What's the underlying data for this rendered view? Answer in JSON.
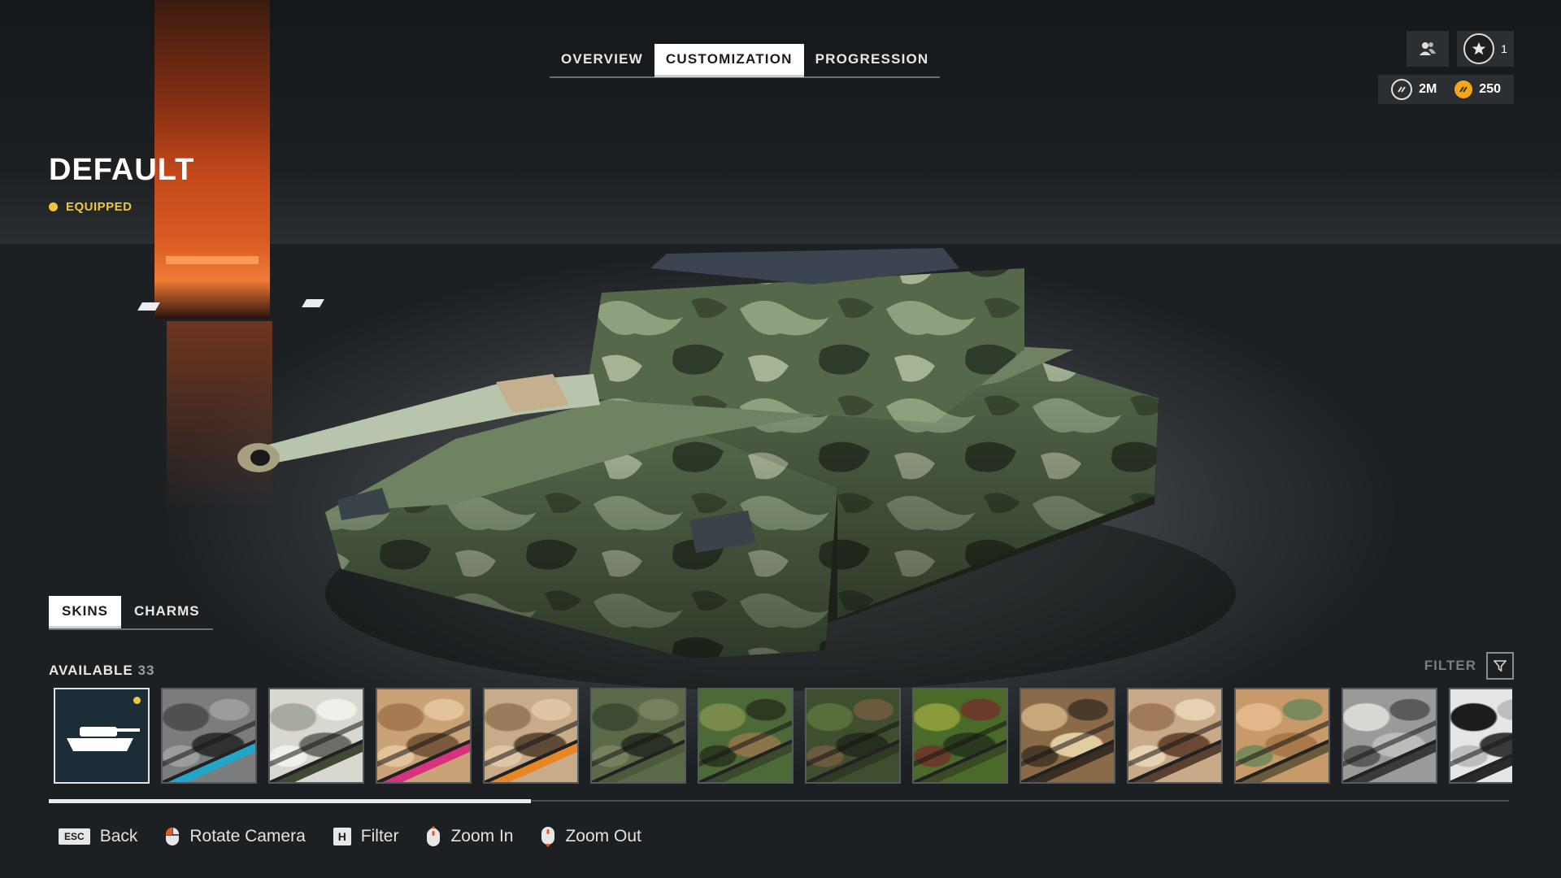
{
  "nav": {
    "tabs": [
      {
        "label": "OVERVIEW"
      },
      {
        "label": "CUSTOMIZATION"
      },
      {
        "label": "PROGRESSION"
      }
    ],
    "active_tab": "CUSTOMIZATION"
  },
  "player": {
    "rank_level": "1"
  },
  "currency": {
    "credits": "2M",
    "gold": "250",
    "gold_color": "#f2a81a"
  },
  "item": {
    "name": "DEFAULT",
    "status": "EQUIPPED",
    "status_color": "#f2c63a"
  },
  "subtabs": [
    {
      "label": "SKINS"
    },
    {
      "label": "CHARMS"
    }
  ],
  "available": {
    "label": "AVAILABLE",
    "count": "33"
  },
  "filter": {
    "label": "FILTER"
  },
  "skins": [
    {
      "name": "default-tank",
      "icon": "tank-icon",
      "selected": true,
      "new": true
    },
    {
      "name": "urban-grey",
      "colors": [
        "#7a7c7e",
        "#4e5052",
        "#9a9c9e",
        "#2f3133"
      ],
      "stripe": "#1fa6c8"
    },
    {
      "name": "snow",
      "colors": [
        "#d8d8d0",
        "#a7aaa0",
        "#f0f0ea",
        "#6c6e66"
      ],
      "stripe": "#3f4a35"
    },
    {
      "name": "desert-tan",
      "colors": [
        "#c9a278",
        "#a67b52",
        "#e2c39c",
        "#7a5a3c"
      ],
      "stripe": "#d8317f"
    },
    {
      "name": "desert-sand",
      "colors": [
        "#c8ab88",
        "#9a7c5c",
        "#ddc5a5",
        "#5e4a36"
      ],
      "stripe": "#e88624"
    },
    {
      "name": "olive",
      "colors": [
        "#5d6a4a",
        "#3e4a32",
        "#76805e",
        "#2b3324"
      ],
      "stripe": "#4a5a3a"
    },
    {
      "name": "woodland",
      "colors": [
        "#4c6a38",
        "#7a8a4a",
        "#2d3a20",
        "#8a7448"
      ],
      "stripe": "#3a4a2a"
    },
    {
      "name": "forest",
      "colors": [
        "#3e4e2e",
        "#5a6e3a",
        "#6c5a3e",
        "#262e1e"
      ],
      "stripe": "#2e3a22"
    },
    {
      "name": "flecktarn",
      "colors": [
        "#4a6a2a",
        "#8a9a3a",
        "#6a3a2a",
        "#2a3a1e"
      ],
      "stripe": "#3a4a24"
    },
    {
      "name": "brown-camo",
      "colors": [
        "#8a6a48",
        "#c8a87a",
        "#4a3a2a",
        "#e2cca2"
      ],
      "stripe": "#3a2e22"
    },
    {
      "name": "tan-brown",
      "colors": [
        "#c8aa88",
        "#a07a5a",
        "#e6d2b2",
        "#6a4a34"
      ],
      "stripe": "#5a4030"
    },
    {
      "name": "desert-green",
      "colors": [
        "#c89a6a",
        "#e2b88a",
        "#7a8a5a",
        "#a87a4a"
      ],
      "stripe": "#6a5a3a"
    },
    {
      "name": "arctic-grey",
      "colors": [
        "#9a9a98",
        "#d8d8d4",
        "#5a5a58",
        "#bcbcb8"
      ],
      "stripe": "#3a3a38"
    },
    {
      "name": "zebra",
      "colors": [
        "#e6e6e6",
        "#1c1c1c",
        "#bdbdbd",
        "#3a3a3a"
      ],
      "stripe": "#2a2a2a"
    },
    {
      "name": "digital-grey",
      "colors": [
        "#a8aaac",
        "#6a6c6e",
        "#dadcde",
        "#3a3c3e"
      ],
      "stripe": "#4a4c4e"
    }
  ],
  "scroll": {
    "progress": 0.33
  },
  "controls": [
    {
      "key": "ESC",
      "label": "Back",
      "icon": "esc-key-icon"
    },
    {
      "key": "",
      "label": "Rotate Camera",
      "icon": "mouse-left-icon"
    },
    {
      "key": "H",
      "label": "Filter",
      "icon": "h-key-icon"
    },
    {
      "key": "",
      "label": "Zoom In",
      "icon": "mouse-scroll-up-icon"
    },
    {
      "key": "",
      "label": "Zoom Out",
      "icon": "mouse-scroll-down-icon"
    }
  ]
}
